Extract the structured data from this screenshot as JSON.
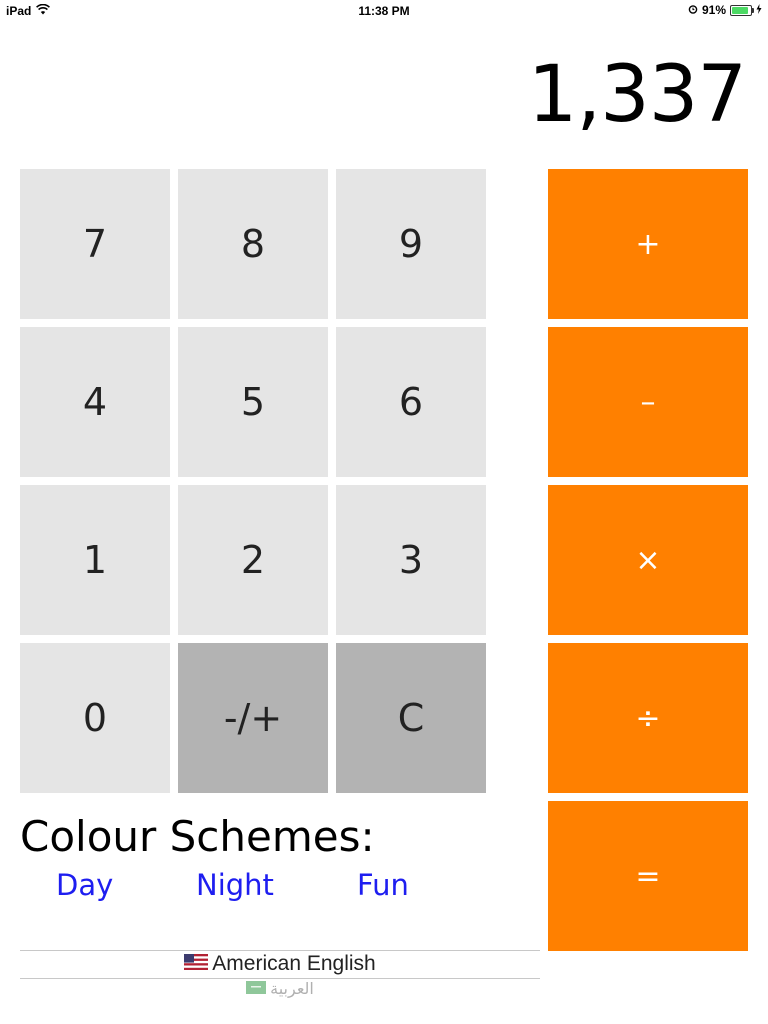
{
  "status_bar": {
    "device": "iPad",
    "time": "11:38 PM",
    "battery_percent": "91%",
    "battery_level": 0.91
  },
  "display": {
    "value": "1,337"
  },
  "keypad": {
    "digits": [
      "7",
      "8",
      "9",
      "4",
      "5",
      "6",
      "1",
      "2",
      "3",
      "0"
    ],
    "negate_label": "-/+",
    "clear_label": "C"
  },
  "operators": {
    "add": "+",
    "subtract": "–",
    "multiply": "×",
    "divide": "÷",
    "equals": "="
  },
  "colour_schemes": {
    "title": "Colour Schemes:",
    "options": [
      "Day",
      "Night",
      "Fun"
    ]
  },
  "language_picker": {
    "selected": "American English",
    "next": "العربية"
  },
  "colors": {
    "operator": "#ff8000",
    "digit": "#e5e5e5",
    "function": "#b3b3b3",
    "link": "#1e1ef0"
  }
}
